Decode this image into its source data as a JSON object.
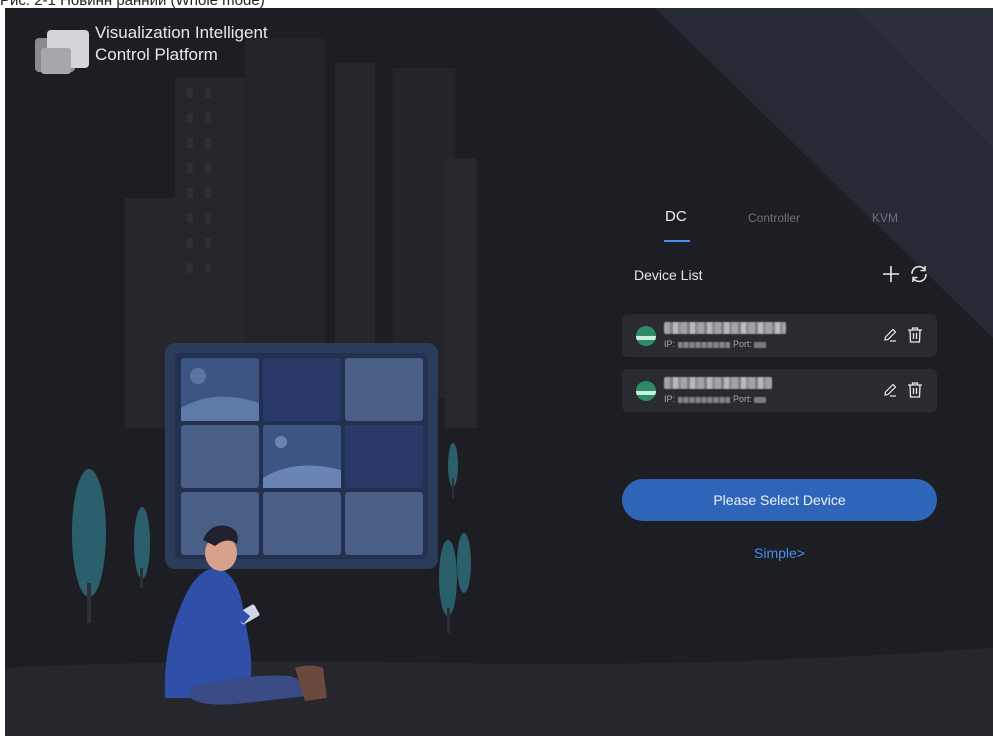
{
  "document": {
    "caption": "Рис. 2-1 Новинн ранний (Whole mode)"
  },
  "brand": {
    "title_line1": "Visualization Intelligent",
    "title_line2": "Control Platform"
  },
  "tabs": [
    {
      "label": "DC",
      "active": true
    },
    {
      "label": "Controller",
      "active": false
    },
    {
      "label": "KVM",
      "active": false
    }
  ],
  "device_list": {
    "title": "Device List",
    "devices": [
      {
        "icon": "dc-device-icon",
        "ip_label": "IP:",
        "port_label": "Port:"
      },
      {
        "icon": "dc-device-icon",
        "ip_label": "IP:",
        "port_label": "Port:"
      }
    ]
  },
  "actions": {
    "select_device_label": "Please Select Device",
    "simple_label": "Simple>"
  },
  "colors": {
    "background": "#1d1e23",
    "card": "#2a2b31",
    "accent": "#4a8ef0",
    "primary_button": "#2f65b8",
    "device_icon": "#2e8c64"
  }
}
